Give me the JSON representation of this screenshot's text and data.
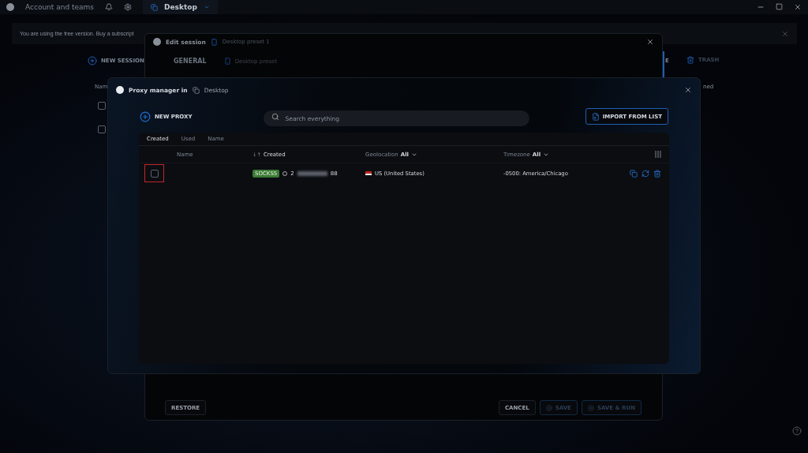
{
  "topbar": {
    "account": "Account and teams",
    "workspace": "Desktop"
  },
  "banner": {
    "text": "You are using the free version. Buy a subscript"
  },
  "background": {
    "new_session": "NEW SESSION",
    "column_1": "Nam",
    "right_tab": "E",
    "trash": "TRASH",
    "column_2": "ned",
    "rows": [
      {
        "checked": false
      },
      {
        "checked": false
      }
    ]
  },
  "edit_session": {
    "title": "Edit session",
    "preset": "Desktop preset 1",
    "section": "GENERAL",
    "preset_select": "Desktop preset",
    "buttons": [
      {
        "label": "RESTORE",
        "kind": "plain"
      },
      {
        "label": "CANCEL",
        "kind": "plain"
      },
      {
        "label": "SAVE",
        "kind": "primary"
      },
      {
        "label": "SAVE & RUN",
        "kind": "primary"
      }
    ]
  },
  "proxy_manager": {
    "title": "Proxy manager in",
    "workspace": "Desktop",
    "new_proxy": "NEW PROXY",
    "search": {
      "placeholder": "Search everything"
    },
    "import": "IMPORT FROM LIST",
    "sort_tabs": [
      {
        "label": "Created",
        "selected": true
      },
      {
        "label": "Used",
        "selected": false
      },
      {
        "label": "Name",
        "selected": false
      }
    ],
    "columns": [
      {
        "label": "Name"
      },
      {
        "label": "Created",
        "sort": "↓↑"
      },
      {
        "label": "Geolocation",
        "filter": "All"
      },
      {
        "label": "Timezone",
        "filter": "All"
      }
    ],
    "rows": [
      {
        "checked": false,
        "highlighted": true,
        "type": "SOCKS5",
        "ip_start": "2",
        "ip_end": "88",
        "geolocation": "US (United States)",
        "timezone": "-0500: America/Chicago"
      }
    ]
  }
}
